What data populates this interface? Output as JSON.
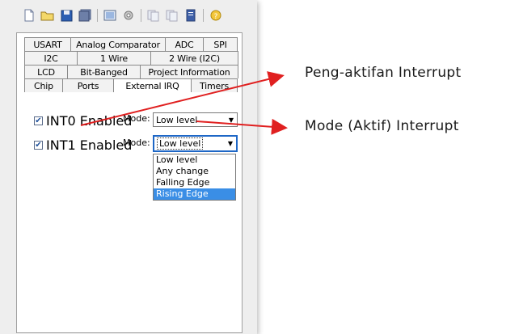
{
  "toolbar": {
    "icons": [
      "new-file-icon",
      "open-folder-icon",
      "save-icon",
      "save-all-icon",
      "preview-icon",
      "settings-gear-icon",
      "copy-icon",
      "paste-icon",
      "document-icon",
      "help-icon"
    ]
  },
  "tabs": {
    "row1": [
      "USART",
      "Analog Comparator",
      "ADC",
      "SPI"
    ],
    "row2": [
      "I2C",
      "1 Wire",
      "2 Wire (I2C)"
    ],
    "row3": [
      "LCD",
      "Bit-Banged",
      "Project Information"
    ],
    "row4": [
      "Chip",
      "Ports",
      "External IRQ",
      "Timers"
    ],
    "active": "External IRQ"
  },
  "int0": {
    "label": "INT0 Enabled",
    "mode_label": "Mode:",
    "mode_value": "Low level",
    "checked": true
  },
  "int1": {
    "label": "INT1 Enabled",
    "mode_label": "Mode:",
    "mode_value": "Low level",
    "checked": true
  },
  "dropdown": {
    "options": [
      "Low level",
      "Any change",
      "Falling Edge",
      "Rising Edge"
    ],
    "highlighted": "Rising Edge"
  },
  "annotations": {
    "note1": "Peng-aktifan Interrupt",
    "note2": "Mode (Aktif) Interrupt",
    "arrow_color": "#e02020"
  }
}
